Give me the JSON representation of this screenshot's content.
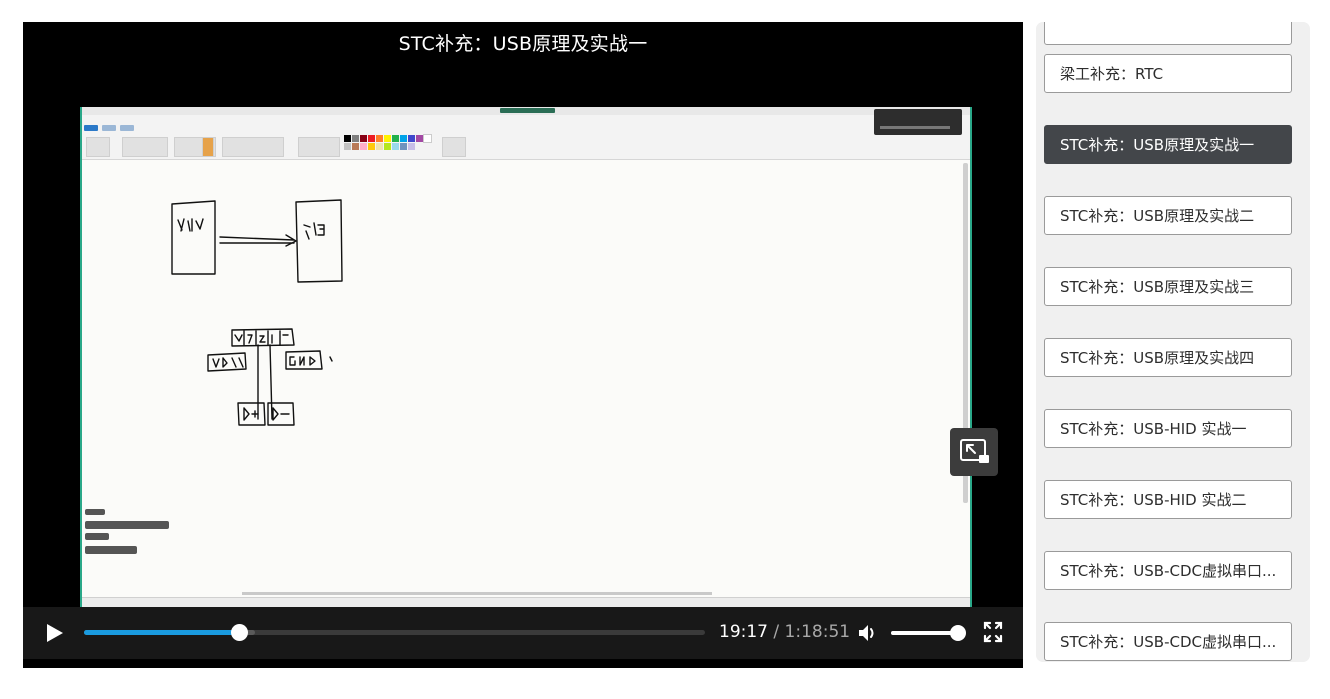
{
  "player": {
    "video_title": "STC补充：USB原理及实战一",
    "time": {
      "current": "19:17",
      "separator": "/",
      "duration": "1:18:51"
    },
    "progress_fraction": 0.25,
    "buffered_fraction": 0.275,
    "volume_fraction": 0.9,
    "icons": {
      "play": "play-icon",
      "volume": "volume-icon",
      "fullscreen": "fullscreen-icon",
      "pip": "exit-picture-in-picture-icon"
    },
    "accent_color": "#1a9be0"
  },
  "playlist": {
    "items": [
      {
        "label": "",
        "active": false
      },
      {
        "label": "梁工补充：RTC",
        "active": false
      },
      {
        "label": "STC补充：USB原理及实战一",
        "active": true
      },
      {
        "label": "STC补充：USB原理及实战二",
        "active": false
      },
      {
        "label": "STC补充：USB原理及实战三",
        "active": false
      },
      {
        "label": "STC补充：USB原理及实战四",
        "active": false
      },
      {
        "label": "STC补充：USB-HID 实战一",
        "active": false
      },
      {
        "label": "STC补充：USB-HID 实战二",
        "active": false
      },
      {
        "label": "STC补充：USB-CDC虚拟串口...",
        "active": false
      },
      {
        "label": "STC补充：USB-CDC虚拟串口...",
        "active": false
      }
    ],
    "active_color": "#43464a"
  }
}
